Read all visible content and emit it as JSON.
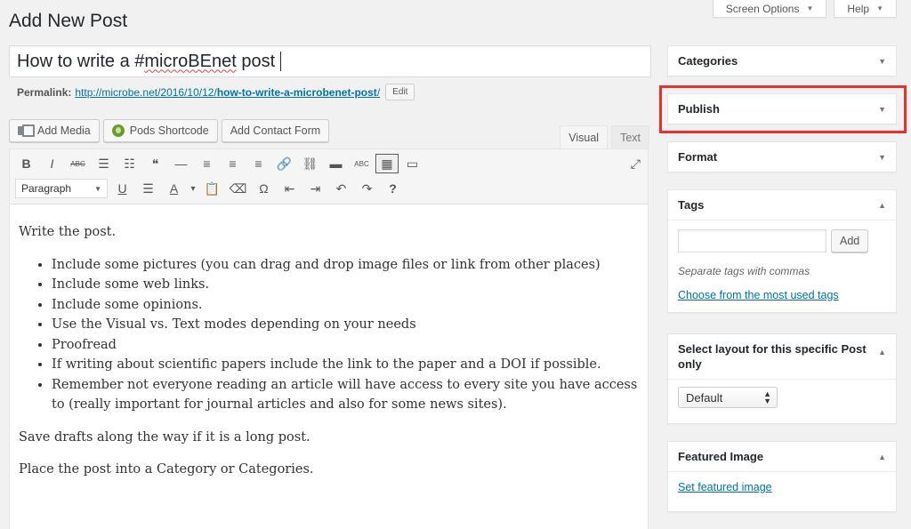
{
  "header": {
    "page_title": "Add New Post",
    "screen_options": "Screen Options",
    "help": "Help"
  },
  "post": {
    "title_before": "How to write a #",
    "title_misspelled": "microBEnet",
    "title_after": " post",
    "permalink_label": "Permalink:",
    "permalink_base": "http://microbe.net/2016/10/12/",
    "permalink_slug": "how-to-write-a-microbenet-post",
    "permalink_end": "/",
    "edit_label": "Edit"
  },
  "media_buttons": {
    "add_media": "Add Media",
    "pods_shortcode": "Pods Shortcode",
    "add_contact_form": "Add Contact Form"
  },
  "editor_tabs": {
    "visual": "Visual",
    "text": "Text"
  },
  "toolbar": {
    "format_select": "Paragraph",
    "icons_row1": [
      {
        "name": "bold-icon",
        "glyph": "B"
      },
      {
        "name": "italic-icon",
        "glyph": "I"
      },
      {
        "name": "strikethrough-icon",
        "glyph": "ABC"
      },
      {
        "name": "bullet-list-icon",
        "glyph": "☰"
      },
      {
        "name": "numbered-list-icon",
        "glyph": "☷"
      },
      {
        "name": "blockquote-icon",
        "glyph": "❝"
      },
      {
        "name": "horizontal-line-icon",
        "glyph": "—"
      },
      {
        "name": "align-left-icon",
        "glyph": "≡"
      },
      {
        "name": "align-center-icon",
        "glyph": "≡"
      },
      {
        "name": "align-right-icon",
        "glyph": "≡"
      },
      {
        "name": "link-icon",
        "glyph": "🔗"
      },
      {
        "name": "unlink-icon",
        "glyph": "⛓"
      },
      {
        "name": "read-more-icon",
        "glyph": "▬"
      },
      {
        "name": "spellcheck-icon",
        "glyph": "ABC"
      },
      {
        "name": "toolbar-toggle-icon",
        "glyph": "▦"
      },
      {
        "name": "distraction-free-icon",
        "glyph": "▭"
      }
    ],
    "icons_row2": [
      {
        "name": "underline-icon",
        "glyph": "U"
      },
      {
        "name": "justify-icon",
        "glyph": "☰"
      },
      {
        "name": "text-color-icon",
        "glyph": "A"
      },
      {
        "name": "text-color-dropdown-icon",
        "glyph": "▾"
      },
      {
        "name": "paste-as-text-icon",
        "glyph": "📋"
      },
      {
        "name": "clear-formatting-icon",
        "glyph": "⌫"
      },
      {
        "name": "special-character-icon",
        "glyph": "Ω"
      },
      {
        "name": "outdent-icon",
        "glyph": "⇤"
      },
      {
        "name": "indent-icon",
        "glyph": "⇥"
      },
      {
        "name": "undo-icon",
        "glyph": "↶"
      },
      {
        "name": "redo-icon",
        "glyph": "↷"
      },
      {
        "name": "keyboard-shortcuts-icon",
        "glyph": "?"
      }
    ]
  },
  "content": {
    "intro": "Write the post.",
    "bullets": [
      "Include some pictures (you can drag and drop image files or link from other places)",
      "Include some web links.",
      "Include some opinions.",
      "Use the Visual vs. Text modes depending on your needs",
      "Proofread",
      "If writing about scientific papers include the link to the paper and a DOI if possible.",
      "Remember not everyone reading an article will have access to every site you have access to (really important for journal articles and also for some news sites)."
    ],
    "p2": "Save drafts along the way if it is a long post.",
    "p3": "Place the post into a Category or Categories."
  },
  "sidebar": {
    "categories": "Categories",
    "publish": "Publish",
    "format": "Format",
    "tags": {
      "title": "Tags",
      "add": "Add",
      "hint": "Separate tags with commas",
      "choose": "Choose from the most used tags"
    },
    "layout": {
      "title": "Select layout for this specific Post only",
      "selected": "Default"
    },
    "featured": {
      "title": "Featured Image",
      "set": "Set featured image"
    }
  },
  "colors": {
    "highlight": "#e8312f",
    "link": "#0073aa"
  }
}
